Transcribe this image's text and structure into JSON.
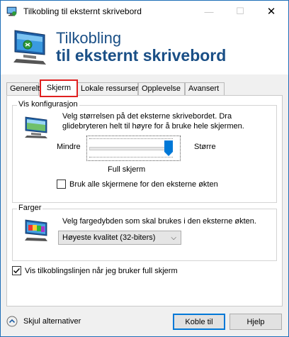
{
  "window": {
    "title": "Tilkobling til eksternt skrivebord",
    "minimize_icon": "minimize-icon",
    "maximize_icon": "maximize-icon",
    "close_icon": "close-icon"
  },
  "banner": {
    "line1": "Tilkobling",
    "line2": "til eksternt skrivebord"
  },
  "tabs": [
    {
      "label": "Generelt",
      "active": false
    },
    {
      "label": "Skjerm",
      "active": true
    },
    {
      "label": "Lokale ressurser",
      "active": false
    },
    {
      "label": "Opplevelse",
      "active": false
    },
    {
      "label": "Avansert",
      "active": false
    }
  ],
  "display_config": {
    "group_title": "Vis konfigurasjon",
    "description": "Velg størrelsen på det eksterne skrivebordet. Dra glidebryteren helt til høyre for å bruke hele skjermen.",
    "slider_min_label": "Mindre",
    "slider_max_label": "Større",
    "slider_value_label": "Full skjerm",
    "slider_position": 1.0,
    "use_all_monitors_label": "Bruk alle skjermene for den eksterne økten",
    "use_all_monitors_checked": false
  },
  "colors": {
    "group_title": "Farger",
    "description": "Velg fargedybden som skal brukes i den eksterne økten.",
    "depth_selected": "Høyeste kvalitet (32-biters)"
  },
  "fullscreen_bar": {
    "label": "Vis tilkoblingslinjen når jeg bruker full skjerm",
    "checked": true
  },
  "footer": {
    "toggle_label": "Skjul alternativer",
    "connect_label": "Koble til",
    "help_label": "Hjelp"
  },
  "accent_colors": {
    "banner_text": "#1a4f86",
    "selected_tab_outline": "#e02020",
    "default_button_border": "#0078d7"
  }
}
